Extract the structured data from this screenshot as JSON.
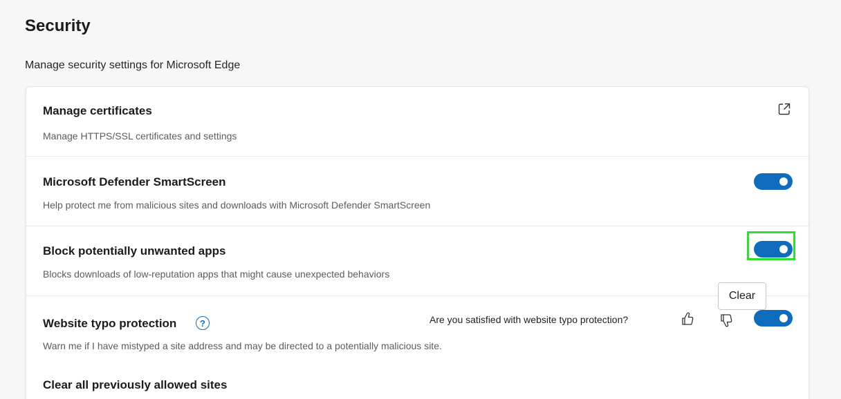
{
  "header": {
    "title": "Security",
    "subtitle": "Manage security settings for Microsoft Edge"
  },
  "settings": [
    {
      "title": "Manage certificates",
      "description": "Manage HTTPS/SSL certificates and settings",
      "control": "external-link-icon"
    },
    {
      "title": "Microsoft Defender SmartScreen",
      "description": "Help protect me from malicious sites and downloads with Microsoft Defender SmartScreen",
      "control": "toggle",
      "enabled": true
    },
    {
      "title": "Block potentially unwanted apps",
      "description": "Blocks downloads of low-reputation apps that might cause unexpected behaviors",
      "control": "toggle",
      "enabled": true
    },
    {
      "title": "Website typo protection",
      "description": "Warn me if I have mistyped a site address and may be directed to a potentially malicious site.",
      "control": "toggle",
      "enabled": true,
      "help_icon": "question-circle-icon",
      "feedback_prompt": "Are you satisfied with website typo protection?",
      "feedback_icons": [
        "thumbs-up-icon",
        "thumbs-down-icon"
      ]
    },
    {
      "title": "Clear all previously allowed sites",
      "button_label": "Clear"
    }
  ],
  "colors": {
    "toggle_on": "#0f6cbd",
    "highlight": "#2ee02e",
    "background": "#f7f7f7",
    "card": "#ffffff"
  }
}
